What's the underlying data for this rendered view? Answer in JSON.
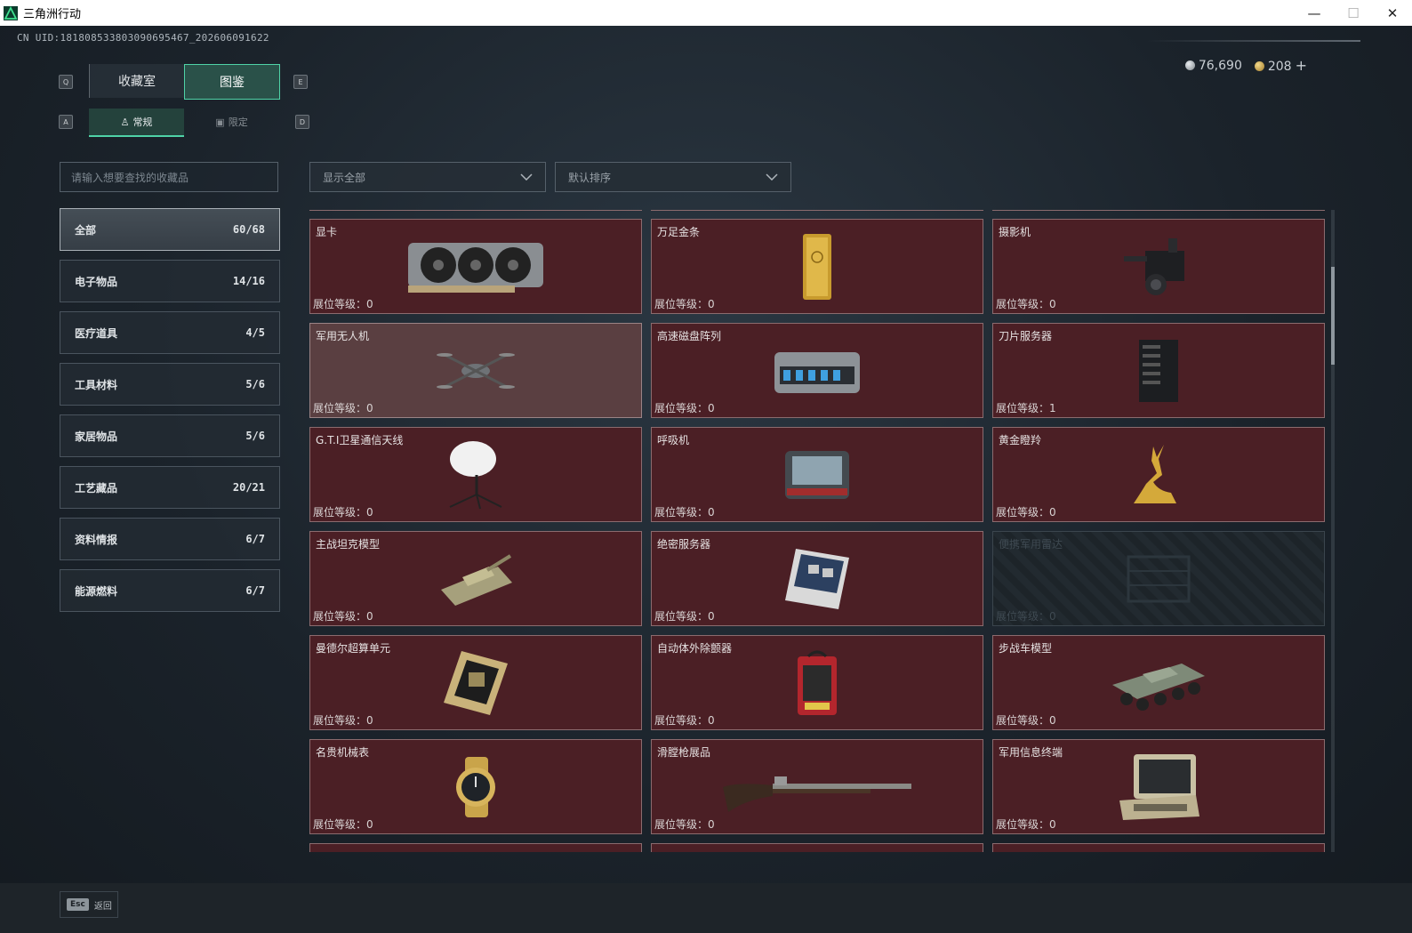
{
  "window": {
    "title": "三角洲行动",
    "minimize": "—",
    "maximize": "☐",
    "close": "✕"
  },
  "uid": "CN UID:1818085338030906954​67_202606091622",
  "currency": {
    "silver": "76,690",
    "gold": "208",
    "add": "+"
  },
  "keys": {
    "prev_tab": "Q",
    "next_tab": "E",
    "prev_sub": "A",
    "next_sub": "D"
  },
  "tabs": [
    {
      "label": "收藏室"
    },
    {
      "label": "图鉴"
    }
  ],
  "subtabs": [
    {
      "label": "常规"
    },
    {
      "label": "限定"
    }
  ],
  "search": {
    "placeholder": "请输入想要查找的收藏品"
  },
  "filters": {
    "show": "显示全部",
    "sort": "默认排序"
  },
  "categories": [
    {
      "label": "全部",
      "count": "60/68"
    },
    {
      "label": "电子物品",
      "count": "14/16"
    },
    {
      "label": "医疗道具",
      "count": "4/5"
    },
    {
      "label": "工具材料",
      "count": "5/6"
    },
    {
      "label": "家居物品",
      "count": "5/6"
    },
    {
      "label": "工艺藏品",
      "count": "20/21"
    },
    {
      "label": "资料情报",
      "count": "6/7"
    },
    {
      "label": "能源燃料",
      "count": "6/7"
    }
  ],
  "level_label": "展位等级：",
  "items": [
    {
      "name": "显卡",
      "level": "0",
      "icon": "gpu-icon"
    },
    {
      "name": "万足金条",
      "level": "0",
      "icon": "gold-bar-icon"
    },
    {
      "name": "摄影机",
      "level": "0",
      "icon": "camera-icon"
    },
    {
      "name": "军用无人机",
      "level": "0",
      "icon": "drone-icon"
    },
    {
      "name": "高速磁盘阵列",
      "level": "0",
      "icon": "disk-array-icon"
    },
    {
      "name": "刀片服务器",
      "level": "1",
      "icon": "blade-server-icon"
    },
    {
      "name": "G.T.I卫星通信天线",
      "level": "0",
      "icon": "satellite-dish-icon"
    },
    {
      "name": "呼吸机",
      "level": "0",
      "icon": "ventilator-icon"
    },
    {
      "name": "黄金瞪羚",
      "level": "0",
      "icon": "golden-gazelle-icon"
    },
    {
      "name": "主战坦克模型",
      "level": "0",
      "icon": "tank-icon"
    },
    {
      "name": "绝密服务器",
      "level": "0",
      "icon": "server-board-icon"
    },
    {
      "name": "便携军用雷达",
      "level": "0",
      "icon": "radar-icon"
    },
    {
      "name": "曼德尔超算单元",
      "level": "0",
      "icon": "supercomputer-icon"
    },
    {
      "name": "自动体外除颤器",
      "level": "0",
      "icon": "defibrillator-icon"
    },
    {
      "name": "步战车模型",
      "level": "0",
      "icon": "ifv-icon"
    },
    {
      "name": "名贵机械表",
      "level": "0",
      "icon": "watch-icon"
    },
    {
      "name": "滑膛枪展品",
      "level": "0",
      "icon": "musket-icon"
    },
    {
      "name": "军用信息终端",
      "level": "0",
      "icon": "terminal-icon"
    }
  ],
  "bottom": {
    "esc_key": "Esc",
    "back": "返回"
  },
  "colors": {
    "accent": "#4fd3a7",
    "cell_bg": "#4b1f25",
    "cell_border": "#8b6b6e"
  }
}
